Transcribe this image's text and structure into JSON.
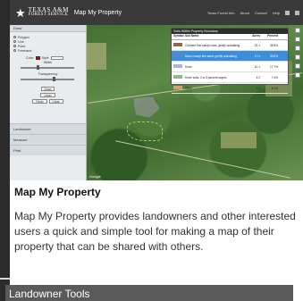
{
  "header": {
    "brand_line1": "TEXAS A&M",
    "brand_line2": "FOREST SERVICE",
    "app_title": "Map My Property",
    "nav": [
      "Texas Forest Info",
      "About",
      "Contact",
      "Help"
    ]
  },
  "panel": {
    "section_top": "Draw",
    "rows": [
      "Polygon",
      "Line",
      "Point",
      "Freehand"
    ],
    "color_label": "Color",
    "style_label": "Style",
    "width_label": "Width",
    "transparency_label": "Transparency",
    "button_draw": "Draw",
    "button_undo": "Undo",
    "button_redo": "Redo",
    "button_clear": "Clear",
    "sections": [
      "Landowner",
      "Measure",
      "Print"
    ]
  },
  "soil_table": {
    "title": "Soils Within Property Boundary",
    "columns": [
      "Symbol",
      "Soil Name",
      "Acres",
      "Percent"
    ],
    "rows": [
      {
        "name": "Cuthbert fine sandy loam, gently undulating",
        "acres": "22.1",
        "percent": "38.8%",
        "color": "#8b6a4a",
        "highlight": false
      },
      {
        "name": "Darco loamy fine sand, gently undulating",
        "acres": "17.1",
        "percent": "30.0%",
        "color": "#5a86c8",
        "highlight": true
      },
      {
        "name": "Kirvin",
        "acres": "10.1",
        "percent": "17.7%",
        "color": "#a9b6d9",
        "highlight": false
      },
      {
        "name": "Kirvin soils, 2 to 5 percent slopes",
        "acres": "4.2",
        "percent": "7.4%",
        "color": "#9bb58a",
        "highlight": false
      },
      {
        "name": "Other",
        "acres": "3.5",
        "percent": "6.1%",
        "color": "#d3a06a",
        "highlight": false
      }
    ]
  },
  "map": {
    "attribution": "Google"
  },
  "article": {
    "title": "Map My Property",
    "description": "Map My Property provides landowners and other interested users a quick and simple tool for making a map of their property that can be shared with others."
  },
  "footer": {
    "tools_label": "Landowner Tools"
  }
}
